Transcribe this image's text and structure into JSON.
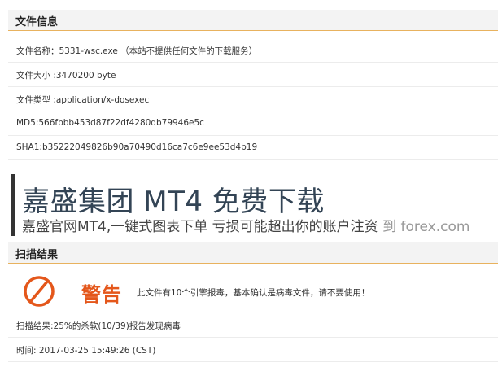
{
  "file_info": {
    "header": "文件信息",
    "name": "文件名称：5331-wsc.exe （本站不提供任何文件的下载服务）",
    "size": "文件大小 :3470200 byte",
    "type": "文件类型 :application/x-dosexec",
    "md5": "MD5:566fbbb453d87f22df4280db79946e5c",
    "sha1": "SHA1:b35222049826b90a70490d16ca7c6e9ee53d4b19"
  },
  "ad": {
    "title": "嘉盛集团 MT4 免费下载",
    "subtitle": "嘉盛官网MT4,一键式图表下单 亏损可能超出你的账户注资",
    "subtitle_suffix": " 到 forex.com"
  },
  "scan": {
    "header": "扫描结果",
    "warning_title": "警告",
    "warning_message": "此文件有10个引擎报毒，基本确认是病毒文件，请不要使用！",
    "result": "扫描结果:25%的杀软(10/39)报告发现病毒",
    "time": "时间: 2017-03-25 15:49:26 (CST)",
    "warning_icon": "prohibited-icon",
    "accent_color": "#e4571b"
  }
}
